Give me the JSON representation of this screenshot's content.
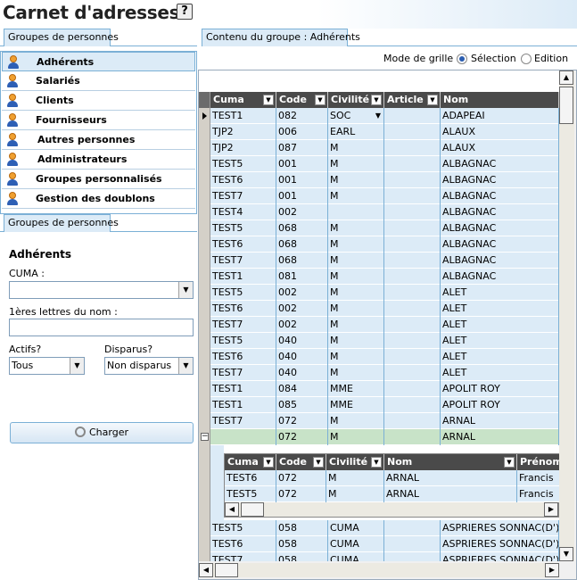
{
  "header": {
    "title": "Carnet d'adresses",
    "help_label": "?"
  },
  "left_tab": "Groupes de personnes",
  "left_tab2": "Groupes de personnes",
  "right_tab": "Contenu du groupe : Adhérents",
  "groups": [
    {
      "label": "Adhérents",
      "selected": true
    },
    {
      "label": "Salariés",
      "selected": false
    },
    {
      "label": "Clients",
      "selected": false
    },
    {
      "label": "Fournisseurs",
      "selected": false
    },
    {
      "label": "Autres personnes",
      "selected": false
    },
    {
      "label": "Administrateurs",
      "selected": false
    },
    {
      "label": "Groupes personnalisés",
      "selected": false
    },
    {
      "label": "Gestion des doublons",
      "selected": false
    }
  ],
  "filter": {
    "heading": "Adhérents",
    "cuma_label": "CUMA :",
    "cuma_value": "",
    "name_label": "1ères lettres du nom :",
    "name_value": "",
    "actifs_label": "Actifs?",
    "actifs_value": "Tous",
    "disparus_label": "Disparus?",
    "disparus_value": "Non disparus",
    "charger_label": "Charger"
  },
  "grid_mode": {
    "label": "Mode de grille :",
    "options": [
      "Sélection",
      "Edition"
    ],
    "selected": "Sélection"
  },
  "grid": {
    "columns": [
      "Cuma",
      "Code",
      "Civilité",
      "Article",
      "Nom"
    ],
    "rows_top": [
      [
        "TEST1",
        "082",
        "SOC",
        "",
        "ADAPEAI"
      ],
      [
        "TJP2",
        "006",
        "EARL",
        "",
        "ALAUX"
      ],
      [
        "TJP2",
        "087",
        "M",
        "",
        "ALAUX"
      ],
      [
        "TEST5",
        "001",
        "M",
        "",
        "ALBAGNAC"
      ],
      [
        "TEST6",
        "001",
        "M",
        "",
        "ALBAGNAC"
      ],
      [
        "TEST7",
        "001",
        "M",
        "",
        "ALBAGNAC"
      ],
      [
        "TEST4",
        "002",
        "",
        "",
        "ALBAGNAC"
      ],
      [
        "TEST5",
        "068",
        "M",
        "",
        "ALBAGNAC"
      ],
      [
        "TEST6",
        "068",
        "M",
        "",
        "ALBAGNAC"
      ],
      [
        "TEST7",
        "068",
        "M",
        "",
        "ALBAGNAC"
      ],
      [
        "TEST1",
        "081",
        "M",
        "",
        "ALBAGNAC"
      ],
      [
        "TEST5",
        "002",
        "M",
        "",
        "ALET"
      ],
      [
        "TEST6",
        "002",
        "M",
        "",
        "ALET"
      ],
      [
        "TEST7",
        "002",
        "M",
        "",
        "ALET"
      ],
      [
        "TEST5",
        "040",
        "M",
        "",
        "ALET"
      ],
      [
        "TEST6",
        "040",
        "M",
        "",
        "ALET"
      ],
      [
        "TEST7",
        "040",
        "M",
        "",
        "ALET"
      ],
      [
        "TEST1",
        "084",
        "MME",
        "",
        "APOLIT ROY"
      ],
      [
        "TEST1",
        "085",
        "MME",
        "",
        "APOLIT ROY"
      ],
      [
        "TEST7",
        "072",
        "M",
        "",
        "ARNAL"
      ],
      [
        "",
        "072",
        "M",
        "",
        "ARNAL"
      ]
    ],
    "sub_columns": [
      "Cuma",
      "Code",
      "Civilité",
      "Nom",
      "Prénom"
    ],
    "sub_rows": [
      [
        "TEST6",
        "072",
        "M",
        "ARNAL",
        "Francis"
      ],
      [
        "TEST5",
        "072",
        "M",
        "ARNAL",
        "Francis"
      ]
    ],
    "rows_bottom": [
      [
        "TEST5",
        "058",
        "CUMA",
        "",
        "ASPRIERES SONNAC(D')"
      ],
      [
        "TEST6",
        "058",
        "CUMA",
        "",
        "ASPRIERES SONNAC(D')"
      ],
      [
        "TEST7",
        "058",
        "CUMA",
        "",
        "ASPRIERES SONNAC(D')"
      ]
    ]
  }
}
